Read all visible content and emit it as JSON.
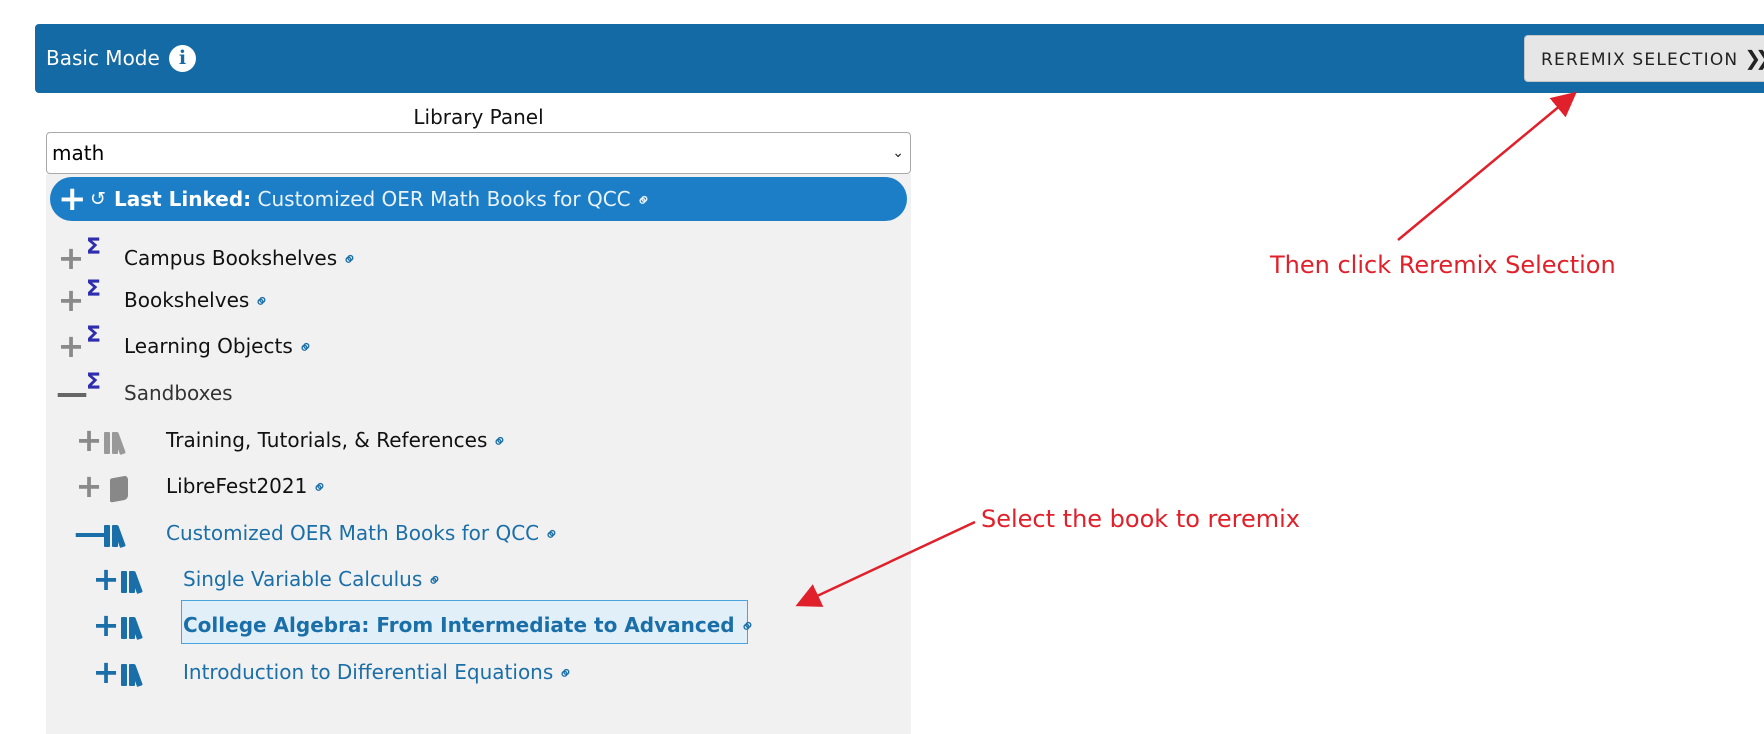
{
  "header": {
    "mode_label": "Basic Mode",
    "info_glyph": "i",
    "reremix_button_label": "REREMIX SELECTION",
    "reremix_chevron": "❯❯"
  },
  "library_panel": {
    "title": "Library Panel",
    "select_value": "math"
  },
  "last_linked": {
    "prefix": "Last Linked:",
    "title": "Customized OER Math Books for QCC"
  },
  "tree": {
    "items": [
      {
        "label": "Campus Bookshelves",
        "toggle": "+",
        "icon": "sigma-icon",
        "link": true
      },
      {
        "label": "Bookshelves",
        "toggle": "+",
        "icon": "sigma-icon",
        "link": true
      },
      {
        "label": "Learning Objects",
        "toggle": "+",
        "icon": "sigma-icon",
        "link": true
      },
      {
        "label": "Sandboxes",
        "toggle": "—",
        "icon": "sigma-icon",
        "link": false
      },
      {
        "label": "Training, Tutorials, & References",
        "toggle": "+",
        "icon": "bookshelf-icon",
        "link": true
      },
      {
        "label": "LibreFest2021",
        "toggle": "+",
        "icon": "book-icon",
        "link": true
      },
      {
        "label": "Customized OER Math Books for QCC",
        "toggle": "—",
        "icon": "bookshelf-icon",
        "link": true
      },
      {
        "label": "Single Variable Calculus",
        "toggle": "+",
        "icon": "bookshelf-icon",
        "link": true
      },
      {
        "label": "College Algebra: From Intermediate to Advanced",
        "toggle": "+",
        "icon": "bookshelf-icon",
        "link": true,
        "selected": true
      },
      {
        "label": "Introduction to Differential Equations",
        "toggle": "+",
        "icon": "bookshelf-icon",
        "link": true
      }
    ]
  },
  "annotations": {
    "reremix_hint": "Then click Reremix Selection",
    "select_hint": "Select the book to reremix"
  },
  "colors": {
    "header_bg": "#136aa4",
    "last_linked_bg": "#1b7ec6",
    "tree_link": "#1b6fa8",
    "annotation": "#e0202a",
    "selected_bg": "#e1eff9"
  }
}
